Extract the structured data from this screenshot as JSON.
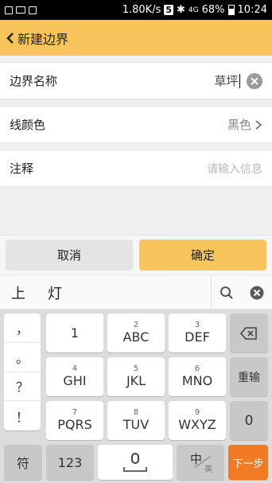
{
  "status": {
    "speed": "1.80K/s",
    "s5": "5",
    "network": "4G",
    "battery": "68%",
    "time": "10:24"
  },
  "header": {
    "title": "新建边界"
  },
  "form": {
    "name_label": "边界名称",
    "name_value": "草坪",
    "color_label": "线颜色",
    "color_value": "黑色",
    "note_label": "注释",
    "note_placeholder": "请输入信息"
  },
  "actions": {
    "cancel": "取消",
    "confirm": "确定"
  },
  "candidates": [
    "上",
    "灯"
  ],
  "keyboard": {
    "punctuation": [
      "，",
      "。",
      "？",
      "！"
    ],
    "keys": [
      {
        "num": "",
        "letters": "1"
      },
      {
        "num": "2",
        "letters": "ABC"
      },
      {
        "num": "3",
        "letters": "DEF"
      },
      {
        "num": "4",
        "letters": "GHI"
      },
      {
        "num": "5",
        "letters": "JKL"
      },
      {
        "num": "6",
        "letters": "MNO"
      },
      {
        "num": "7",
        "letters": "PQRS"
      },
      {
        "num": "8",
        "letters": "TUV"
      },
      {
        "num": "9",
        "letters": "WXYZ"
      }
    ],
    "reenter": "重输",
    "zero": "0",
    "symbol": "符",
    "num_mode": "123",
    "lang_zh": "中",
    "lang_en": "英",
    "next": "下一步"
  },
  "colors": {
    "accent": "#f8c45c",
    "next_key": "#f27a22"
  }
}
